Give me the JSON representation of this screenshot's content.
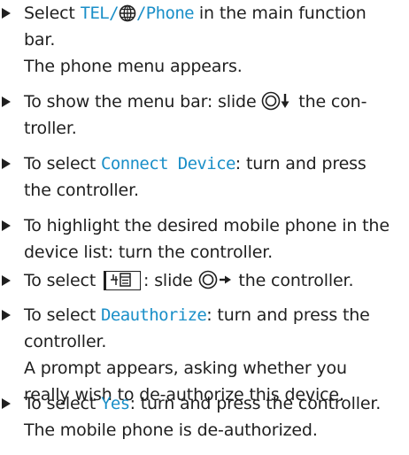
{
  "steps": [
    {
      "lines": [
        {
          "pre": "Select ",
          "term1": "TEL/",
          "term2": "/Phone",
          "post": " in the main function"
        },
        {
          "text": "bar."
        },
        {
          "text": "The phone menu appears."
        }
      ]
    },
    {
      "lines": [
        {
          "pre": "To show the menu bar: slide ",
          "post": " the con-"
        },
        {
          "text": "troller."
        }
      ]
    },
    {
      "lines": [
        {
          "pre": "To select ",
          "term": "Connect Device",
          "post": ": turn and press"
        },
        {
          "text": "the controller."
        }
      ]
    },
    {
      "lines": [
        {
          "text": "To highlight the desired mobile phone in the"
        },
        {
          "text": "device list: turn the controller."
        }
      ]
    },
    {
      "lines": [
        {
          "pre": "To select ",
          "mid": ": slide ",
          "post": " the controller."
        }
      ]
    },
    {
      "lines": [
        {
          "pre": "To select ",
          "term": "Deauthorize",
          "post": ": turn and press the"
        },
        {
          "text": "controller."
        },
        {
          "text": "A prompt appears, asking whether you"
        },
        {
          "text": "really wish to de-authorize this device."
        }
      ]
    },
    {
      "lines": [
        {
          "pre": "To select ",
          "term": "Yes",
          "post": ": turn and press the controller."
        },
        {
          "text": "The mobile phone is de-authorized."
        }
      ]
    }
  ],
  "icons": {
    "globe": "globe-icon",
    "controller_down": "controller-slide-down-icon",
    "controller_right": "controller-slide-right-icon",
    "menu_symbol": "menu-symbol-icon",
    "bullet": "triangle-bullet-icon"
  },
  "colors": {
    "text": "#1f1f1f",
    "term": "#1a8fc8",
    "background": "#ffffff"
  }
}
